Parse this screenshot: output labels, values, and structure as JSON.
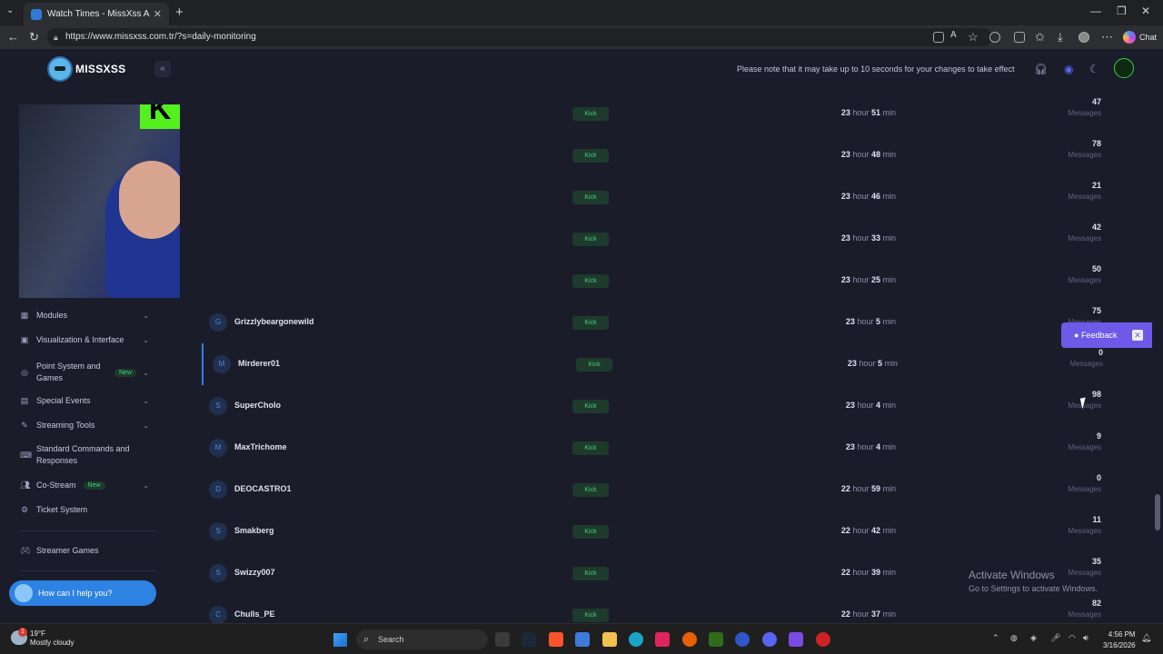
{
  "browser": {
    "tab_title": "Watch Times - MissXss AI Bot Syst",
    "url": "https://www.missxss.com.tr/?s=daily-monitoring",
    "chat_label": "Chat"
  },
  "header": {
    "logo_text": "MISSXSS",
    "notice": "Please note that it may take up to 10 seconds for your changes to take effect"
  },
  "sidebar": {
    "stream_badge": "K",
    "items": [
      {
        "label": "Modules",
        "icon": "grid-icon",
        "badge": ""
      },
      {
        "label": "Visualization & Interface",
        "icon": "bag-icon",
        "badge": ""
      },
      {
        "label": "Point System and Games",
        "icon": "coin-icon",
        "badge": "New"
      },
      {
        "label": "Special Events",
        "icon": "calendar-icon",
        "badge": ""
      },
      {
        "label": "Streaming Tools",
        "icon": "tools-icon",
        "badge": ""
      },
      {
        "label": "Standard Commands and Responses",
        "icon": "keyboard-icon",
        "badge": ""
      },
      {
        "label": "Co-Stream",
        "icon": "users-icon",
        "badge": "New"
      },
      {
        "label": "Ticket System",
        "icon": "ticket-icon",
        "badge": ""
      },
      {
        "label": "Streamer Games",
        "icon": "gamepad-icon",
        "badge": ""
      }
    ],
    "help_label": "How can I help you?"
  },
  "rows": [
    {
      "initial": "",
      "name": "",
      "platform": "Kick",
      "hours": "23",
      "minutes": "51",
      "messages": "47"
    },
    {
      "initial": "",
      "name": "",
      "platform": "Kick",
      "hours": "23",
      "minutes": "48",
      "messages": "78"
    },
    {
      "initial": "",
      "name": "",
      "platform": "Kick",
      "hours": "23",
      "minutes": "46",
      "messages": "21"
    },
    {
      "initial": "",
      "name": "",
      "platform": "Kick",
      "hours": "23",
      "minutes": "33",
      "messages": "42"
    },
    {
      "initial": "",
      "name": "",
      "platform": "Kick",
      "hours": "23",
      "minutes": "25",
      "messages": "50"
    },
    {
      "initial": "G",
      "name": "Grizzlybeargonewild",
      "platform": "Kick",
      "hours": "23",
      "minutes": "5",
      "messages": "75"
    },
    {
      "initial": "M",
      "name": "Mirderer01",
      "platform": "Kick",
      "hours": "23",
      "minutes": "5",
      "messages": "0"
    },
    {
      "initial": "S",
      "name": "SuperCholo",
      "platform": "Kick",
      "hours": "23",
      "minutes": "4",
      "messages": "98"
    },
    {
      "initial": "M",
      "name": "MaxTrichome",
      "platform": "Kick",
      "hours": "23",
      "minutes": "4",
      "messages": "9"
    },
    {
      "initial": "D",
      "name": "DEOCASTRO1",
      "platform": "Kick",
      "hours": "22",
      "minutes": "59",
      "messages": "0"
    },
    {
      "initial": "S",
      "name": "Smakberg",
      "platform": "Kick",
      "hours": "22",
      "minutes": "42",
      "messages": "11"
    },
    {
      "initial": "S",
      "name": "Swizzy007",
      "platform": "Kick",
      "hours": "22",
      "minutes": "39",
      "messages": "35"
    },
    {
      "initial": "C",
      "name": "Chulls_PE",
      "platform": "Kick",
      "hours": "22",
      "minutes": "37",
      "messages": "82"
    }
  ],
  "labels": {
    "hour": "hour",
    "min": "min",
    "messages": "Messages"
  },
  "feedback_label": "Feedback",
  "activation": {
    "line1": "Activate Windows",
    "line2": "Go to Settings to activate Windows."
  },
  "taskbar": {
    "temperature": "19°F",
    "condition": "Mostly cloudy",
    "weather_badge": "1",
    "search_placeholder": "Search",
    "time": "4:56 PM",
    "date": "3/16/2026"
  }
}
